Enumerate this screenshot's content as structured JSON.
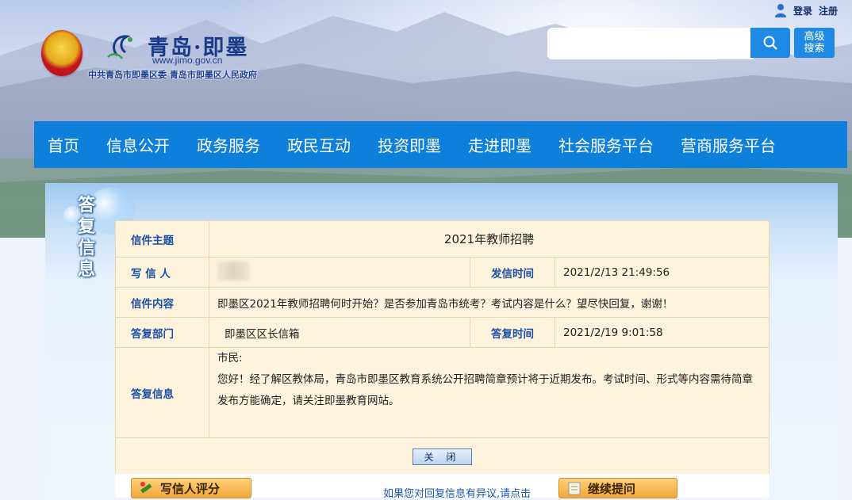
{
  "header": {
    "logo_cn": "青岛·即墨",
    "logo_url": "www.jimo.gov.cn",
    "logo_sub": "中共青岛市即墨区委  青岛市即墨区人民政府",
    "login": "登录",
    "register": "注册",
    "search_placeholder": "",
    "advanced_search": "高级\n搜索"
  },
  "nav": {
    "items": [
      "首页",
      "信息公开",
      "政务服务",
      "政民互动",
      "投资即墨",
      "走进即墨",
      "社会服务平台",
      "营商服务平台"
    ]
  },
  "side_title": "答复信息",
  "letter": {
    "subject_label": "信件主题",
    "subject": "2021年教师招聘",
    "writer_label": "写 信 人",
    "sent_time_label": "发信时间",
    "sent_time": "2021/2/13 21:49:56",
    "content_label": "信件内容",
    "content": "即墨区2021年教师招聘何时开始？是否参加青岛市统考？考试内容是什么？望尽快回复，谢谢！",
    "dept_label": "答复部门",
    "dept": "即墨区区长信箱",
    "reply_time_label": "答复时间",
    "reply_time": "2021/2/19 9:01:58",
    "reply_label": "答复信息",
    "reply_greeting": "市民:",
    "reply_body": "您好！经了解区教体局，青岛市即墨区教育系统公开招聘简章预计将于近期发布。考试时间、形式等内容需待简章发布方能确定，请关注即墨教育网站。",
    "close_label": "关 闭"
  },
  "bottom": {
    "rate_button": "写信人评分",
    "link_text": "如果您对回复信息有异议,请点击",
    "ask_button": "继续提问"
  }
}
